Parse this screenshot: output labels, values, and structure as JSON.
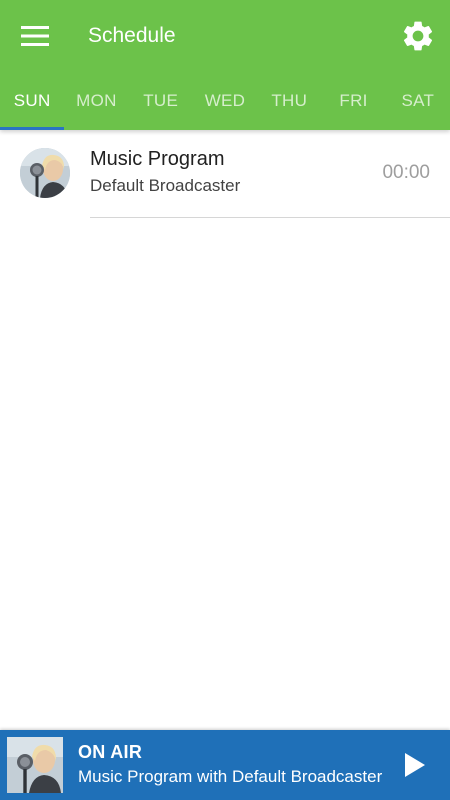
{
  "theme": {
    "primary": "#6cc24a",
    "tab_indicator": "#2a74c4",
    "player_background": "#1f70b8"
  },
  "header": {
    "title": "Schedule",
    "menu_icon": "hamburger-menu-icon",
    "settings_icon": "gear-icon"
  },
  "tabs": [
    {
      "label": "SUN",
      "active": true
    },
    {
      "label": "MON",
      "active": false
    },
    {
      "label": "TUE",
      "active": false
    },
    {
      "label": "WED",
      "active": false
    },
    {
      "label": "THU",
      "active": false
    },
    {
      "label": "FRI",
      "active": false
    },
    {
      "label": "SAT",
      "active": false
    }
  ],
  "schedule": {
    "items": [
      {
        "title": "Music Program",
        "subtitle": "Default Broadcaster",
        "time": "00:00",
        "image": "broadcaster-photo"
      }
    ]
  },
  "player": {
    "status": "ON AIR",
    "track": "Music Program with Default Broadcaster",
    "image": "broadcaster-photo",
    "play_icon": "play-icon"
  }
}
